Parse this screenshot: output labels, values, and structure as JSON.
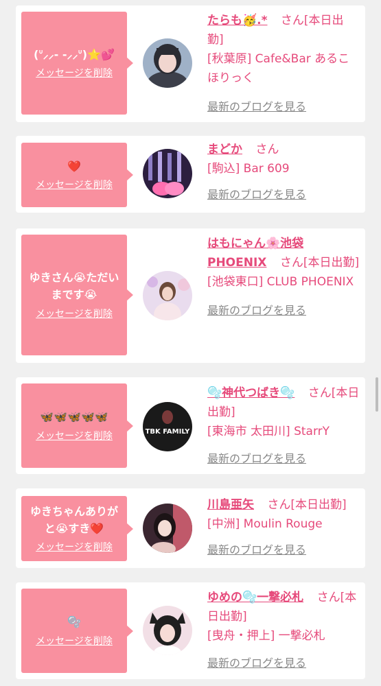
{
  "delete_label": "メッセージを削除",
  "blog_label": "最新のブログを見る",
  "honorific": "さん",
  "accent_color": "#e64a7b",
  "bubble_color": "#f9909f",
  "items": [
    {
      "message": "(ᐡ⸝⸝- -⸝⸝ᐡ)⭐💕",
      "name": "たらも🥳.*",
      "status": "[本日出勤]",
      "shop": "[秋葉原] Cafe&Bar あるこほりっく"
    },
    {
      "message": "❤️",
      "name": "まどか",
      "status": "",
      "shop": "[駒込] Bar 609"
    },
    {
      "message": "ゆきさん😭ただいまです😭",
      "name": "はもにゃん🌸池袋PHOENIX",
      "status": "[本日出勤]",
      "shop": "[池袋東口] CLUB PHOENIX"
    },
    {
      "message": "🦋🦋🦋🦋🦋",
      "name": "🫧神代つばき🫧",
      "status": "[本日出勤]",
      "shop": "[東海市 太田川] StarrY",
      "avatar_text": "TBK FAMILY"
    },
    {
      "message": "ゆきちゃんありがと😭すき❤️",
      "name": "川島亜矢",
      "status": "[本日出勤]",
      "shop": "[中洲] Moulin Rouge"
    },
    {
      "message": "🫧",
      "name": "ゆめの🫧一撃必札",
      "status": "[本日出勤]",
      "shop": "[曳舟・押上] 一撃必札"
    }
  ]
}
